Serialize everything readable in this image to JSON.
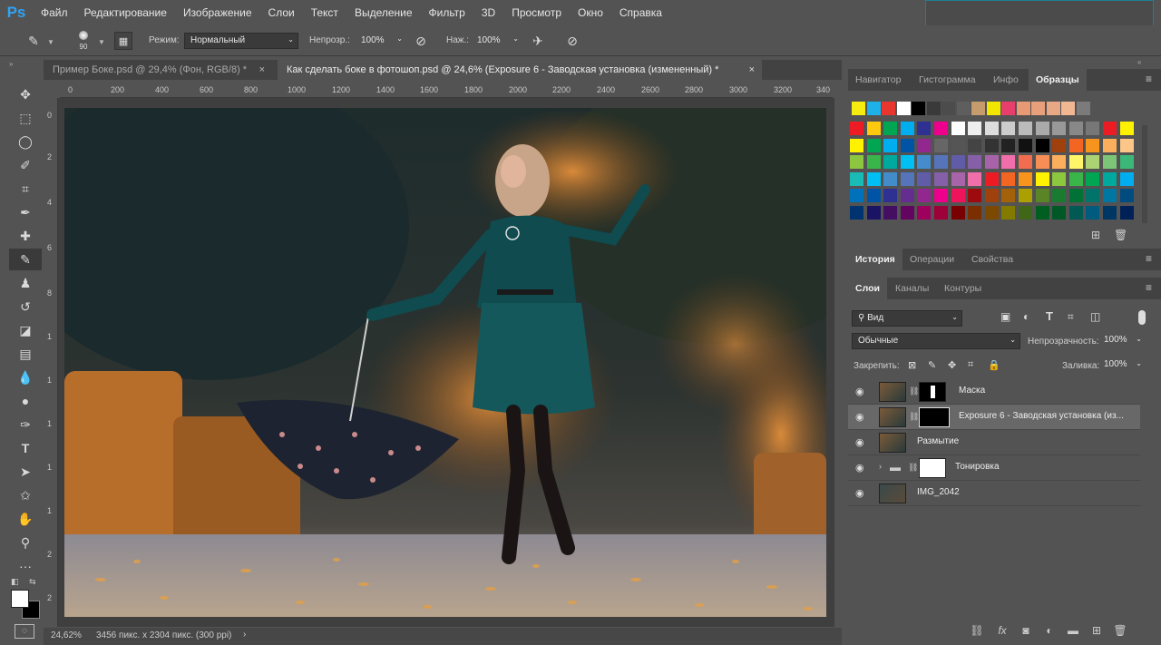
{
  "app": {
    "logo": "Ps"
  },
  "menu": [
    "Файл",
    "Редактирование",
    "Изображение",
    "Слои",
    "Текст",
    "Выделение",
    "Фильтр",
    "3D",
    "Просмотр",
    "Окно",
    "Справка"
  ],
  "options": {
    "brush_size": "90",
    "mode_label": "Режим:",
    "mode_value": "Нормальный",
    "opacity_label": "Непрозр.:",
    "opacity_value": "100%",
    "flow_label": "Наж.:",
    "flow_value": "100%"
  },
  "tabs": [
    {
      "label": "Пример Боке.psd @ 29,4% (Фон, RGB/8) *",
      "close": "×"
    },
    {
      "label": "Как сделать боке в фотошоп.psd @ 24,6% (Exposure 6 - Заводская установка (измененный) *",
      "close": "×"
    }
  ],
  "ruler_h": [
    "0",
    "200",
    "400",
    "600",
    "800",
    "1000",
    "1200",
    "1400",
    "1600",
    "1800",
    "2000",
    "2200",
    "2400",
    "2600",
    "2800",
    "3000",
    "3200",
    "340"
  ],
  "ruler_v": [
    "0",
    "2",
    "4",
    "6",
    "8",
    "1",
    "1",
    "1",
    "1",
    "1",
    "2",
    "2"
  ],
  "status": {
    "zoom": "24,62%",
    "doc_info": "3456 пикс. x 2304 пикс. (300 ppi)",
    "arrow": "›"
  },
  "panel_top": {
    "tabs": [
      "Навигатор",
      "Гистограмма",
      "Инфо",
      "Образцы"
    ],
    "swatch_colors_row1": [
      "#f7ec0f",
      "#1eb0e8",
      "#e8352e",
      "#ffffff",
      "#000000",
      "#3a3a3a",
      "#4c4c4c",
      "#5e5e5e",
      "#c69c6d",
      "#f0e600",
      "#e83e6c",
      "#e89a74",
      "#e8a07a",
      "#e8a885",
      "#f0b792",
      "#7b7b7b"
    ],
    "swatch_grid": [
      [
        "#ed1c24",
        "#ffc90e",
        "#00a651",
        "#00aeef",
        "#2e3192",
        "#ec008c",
        "#ffffff",
        "#eeeeee",
        "#dddddd",
        "#cccccc",
        "#bbbbbb",
        "#aaaaaa",
        "#999999",
        "#888888",
        "#777777",
        "#ec1c24",
        "#fff200"
      ],
      [
        "#fff200",
        "#00a651",
        "#00aeef",
        "#0054a6",
        "#92278f",
        "#666666",
        "#555555",
        "#444444",
        "#333333",
        "#222222",
        "#111111",
        "#000000",
        "#a0410d",
        "#f26522",
        "#f7941d",
        "#fbaf5d",
        "#fdc689"
      ],
      [
        "#8dc63f",
        "#39b54a",
        "#00a99d",
        "#00bff3",
        "#448ccb",
        "#5574b9",
        "#605ca8",
        "#8560a8",
        "#a763a8",
        "#f06eaa",
        "#f26c4f",
        "#f68e56",
        "#fbaf5d",
        "#fff568",
        "#acd373",
        "#7cc576",
        "#3bb878"
      ],
      [
        "#1abbb4",
        "#00bff3",
        "#438cca",
        "#5574b9",
        "#605ca8",
        "#855fa8",
        "#a864a8",
        "#f06ea9",
        "#ed1c24",
        "#f26522",
        "#f7941d",
        "#fff200",
        "#8dc63f",
        "#39b54a",
        "#00a651",
        "#00a99d",
        "#00aeef"
      ],
      [
        "#0072bc",
        "#0054a6",
        "#2e3192",
        "#662d91",
        "#92278f",
        "#ec008c",
        "#ed145b",
        "#9e0b0f",
        "#a0410d",
        "#a36209",
        "#aba000",
        "#598527",
        "#197b30",
        "#007236",
        "#00746b",
        "#0076a3",
        "#004b80"
      ],
      [
        "#003471",
        "#1b1464",
        "#440e62",
        "#630460",
        "#9e005d",
        "#9e0039",
        "#790000",
        "#7b2e00",
        "#7d4900",
        "#827b00",
        "#406618",
        "#005e20",
        "#005826",
        "#005952",
        "#005b7f",
        "#003663",
        "#002157"
      ]
    ]
  },
  "panel_history_tabs": [
    "История",
    "Операции",
    "Свойства"
  ],
  "layers": {
    "tabs": [
      "Слои",
      "Каналы",
      "Контуры"
    ],
    "filter_label": "Вид",
    "blend_mode": "Обычные",
    "opacity_label": "Непрозрачность:",
    "opacity_value": "100%",
    "lock_label": "Закрепить:",
    "fill_label": "Заливка:",
    "fill_value": "100%",
    "items": [
      {
        "name": "Маска"
      },
      {
        "name": "Exposure 6 - Заводская установка (из..."
      },
      {
        "name": "Размытие"
      },
      {
        "name": "Тонировка"
      },
      {
        "name": "IMG_2042"
      }
    ]
  }
}
